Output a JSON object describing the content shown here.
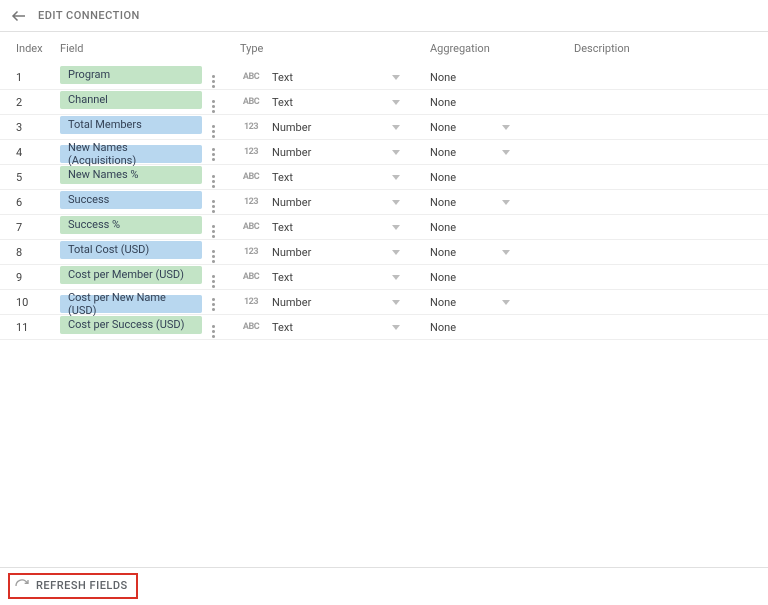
{
  "header": {
    "title": "EDIT CONNECTION"
  },
  "columns": {
    "index": "Index",
    "field": "Field",
    "type": "Type",
    "aggregation": "Aggregation",
    "description": "Description"
  },
  "type_icons": {
    "text": "ABC",
    "number": "123"
  },
  "rows": [
    {
      "index": "1",
      "field": "Program",
      "color": "green",
      "type": "Text",
      "agg": "None",
      "arrow": false
    },
    {
      "index": "2",
      "field": "Channel",
      "color": "green",
      "type": "Text",
      "agg": "None",
      "arrow": false
    },
    {
      "index": "3",
      "field": "Total Members",
      "color": "blue",
      "type": "Number",
      "agg": "None",
      "arrow": true
    },
    {
      "index": "4",
      "field": "New Names (Acquisitions)",
      "color": "blue",
      "type": "Number",
      "agg": "None",
      "arrow": true
    },
    {
      "index": "5",
      "field": "New Names %",
      "color": "green",
      "type": "Text",
      "agg": "None",
      "arrow": false
    },
    {
      "index": "6",
      "field": "Success",
      "color": "blue",
      "type": "Number",
      "agg": "None",
      "arrow": true
    },
    {
      "index": "7",
      "field": "Success %",
      "color": "green",
      "type": "Text",
      "agg": "None",
      "arrow": false
    },
    {
      "index": "8",
      "field": "Total Cost (USD)",
      "color": "blue",
      "type": "Number",
      "agg": "None",
      "arrow": true
    },
    {
      "index": "9",
      "field": "Cost per Member (USD)",
      "color": "green",
      "type": "Text",
      "agg": "None",
      "arrow": false
    },
    {
      "index": "10",
      "field": "Cost per New Name (USD)",
      "color": "blue",
      "type": "Number",
      "agg": "None",
      "arrow": true
    },
    {
      "index": "11",
      "field": "Cost per Success (USD)",
      "color": "green",
      "type": "Text",
      "agg": "None",
      "arrow": false
    }
  ],
  "footer": {
    "refresh_label": "REFRESH FIELDS"
  }
}
